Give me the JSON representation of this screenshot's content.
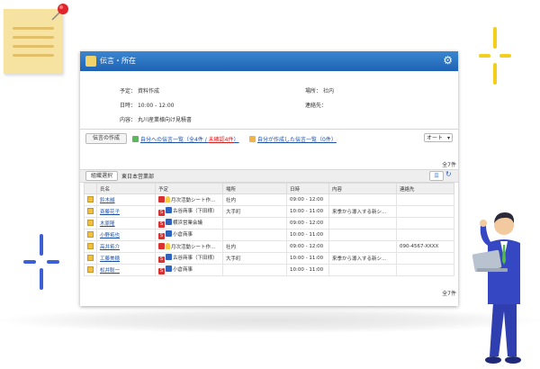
{
  "window": {
    "title": "伝言・所在",
    "detail": {
      "schedule_label": "予定：",
      "schedule_value": "資料作成",
      "place_label": "場所：",
      "place_value": "社内",
      "datetime_label": "日時：",
      "datetime_value": "10:00 - 12:00",
      "contact_label": "連絡先：",
      "content_label": "内容：",
      "content_value": "丸川産業様向け見積書"
    },
    "toolbar": {
      "create_button": "伝言の作成",
      "link_to_me": "自分への伝言一覧（全4件 / ",
      "link_to_me_unconfirmed": "未確認4件",
      "link_to_me_tail": "）",
      "link_by_me": "自分が作成した伝言一覧（0件）",
      "auto_select": "オート"
    },
    "count_top": "全7件",
    "filter": {
      "select_button": "組織選択",
      "org_name": "東日本営業部"
    },
    "columns": [
      "",
      "氏名",
      "予定",
      "場所",
      "日時",
      "内容",
      "連絡先"
    ],
    "rows": [
      {
        "name": "鈴木誠",
        "badge": "",
        "bulb": true,
        "schedule": "月次活動シート作…",
        "place": "社内",
        "time": "09:00 - 12:00",
        "content": "",
        "contact": ""
      },
      {
        "name": "斉藤花子",
        "badge": "S",
        "bulb": false,
        "schedule": "古谷商事（下田様）",
        "place": "大手町",
        "time": "10:00 - 11:00",
        "content": "来季から導入する新シ…",
        "contact": ""
      },
      {
        "name": "木原隆",
        "badge": "S",
        "bulb": false,
        "schedule": "横浜営業会議",
        "place": "",
        "time": "09:00 - 12:00",
        "content": "",
        "contact": ""
      },
      {
        "name": "小野拓也",
        "badge": "S",
        "bulb": false,
        "schedule": "小倉商事",
        "place": "",
        "time": "10:00 - 11:00",
        "content": "",
        "contact": ""
      },
      {
        "name": "高井拓介",
        "badge": "",
        "bulb": true,
        "schedule": "月次活動シート作…",
        "place": "社内",
        "time": "09:00 - 12:00",
        "content": "",
        "contact": "090-4567-XXXX"
      },
      {
        "name": "工藤美穂",
        "badge": "S",
        "bulb": false,
        "schedule": "古谷商事（下田様）",
        "place": "大手町",
        "time": "10:00 - 11:00",
        "content": "来季から導入する新シ…",
        "contact": ""
      },
      {
        "name": "松井聡一",
        "badge": "S",
        "bulb": false,
        "schedule": "小倉商事",
        "place": "",
        "time": "10:00 - 11:00",
        "content": "",
        "contact": ""
      }
    ],
    "count_bottom": "全7件"
  },
  "colors": {
    "title_bar": "#2a74c4",
    "link": "#1b4fa8",
    "badge_red": "#d93030",
    "badge_blue": "#2f63c0",
    "cross_yellow": "#f2cf1d",
    "cross_blue": "#3c5fd6",
    "pin_red": "#e0262c",
    "note_yellow": "#f6e3a1"
  },
  "icons": [
    "gear-icon",
    "memo-icon",
    "pin-icon",
    "refresh-icon",
    "list-view-icon"
  ]
}
